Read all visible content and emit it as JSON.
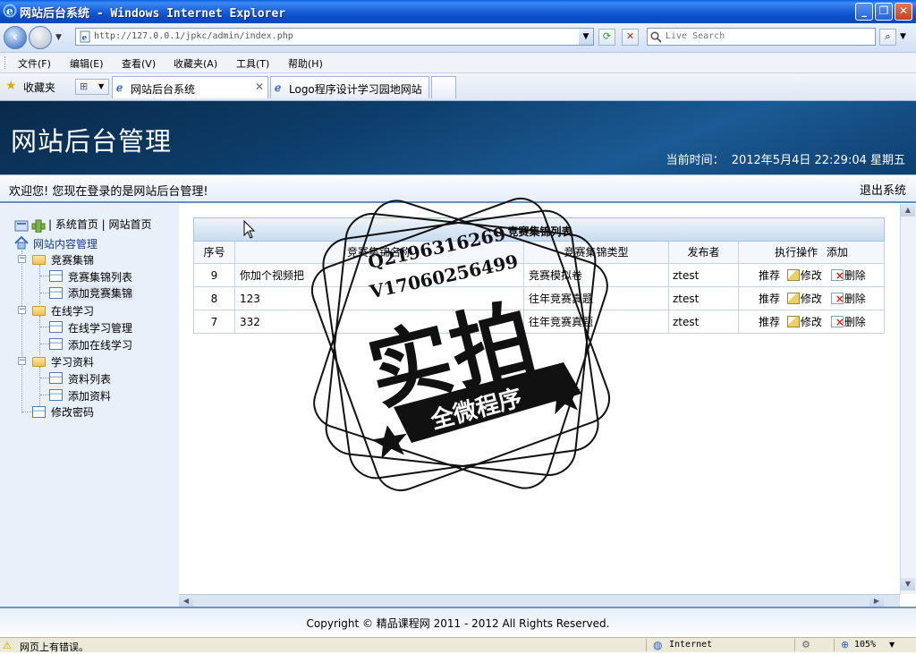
{
  "window": {
    "title": "网站后台系统 - Windows Internet Explorer",
    "minimize": "_",
    "restore": "❐",
    "close": "✕"
  },
  "address": {
    "url": "http://127.0.0.1/jpkc/admin/index.php",
    "search_placeholder": "Live Search"
  },
  "menu": [
    "文件(F)",
    "编辑(E)",
    "查看(V)",
    "收藏夹(A)",
    "工具(T)",
    "帮助(H)"
  ],
  "favorites_label": "收藏夹",
  "tabs": [
    {
      "label": "网站后台系统",
      "active": true
    },
    {
      "label": "Logo程序设计学习园地网站",
      "active": false
    }
  ],
  "header": {
    "site_title": "网站后台管理",
    "time_label": "当前时间：",
    "time_value": "2012年5月4日 22:29:04 星期五"
  },
  "welcome": {
    "text": "欢迎您! 您现在登录的是网站后台管理!",
    "logout": "退出系统"
  },
  "sidebar": {
    "top_links": "| 系统首页 | 网站首页",
    "root": "网站内容管理",
    "groups": [
      {
        "label": "竞赛集锦",
        "items": [
          "竞赛集锦列表",
          "添加竞赛集锦"
        ]
      },
      {
        "label": "在线学习",
        "items": [
          "在线学习管理",
          "添加在线学习"
        ]
      },
      {
        "label": "学习资料",
        "items": [
          "资料列表",
          "添加资料"
        ]
      }
    ],
    "change_password": "修改密码"
  },
  "table": {
    "caption": "竞赛集锦列表",
    "columns": [
      "序号",
      "竞赛集锦名称",
      "竞赛集锦类型",
      "发布者",
      "执行操作",
      "添加"
    ],
    "rows": [
      {
        "id": "9",
        "name": "你加个视频把",
        "type": "竞赛模拟卷",
        "author": "ztest"
      },
      {
        "id": "8",
        "name": "123",
        "type": "往年竞赛真题",
        "author": "ztest"
      },
      {
        "id": "7",
        "name": "332",
        "type": "往年竞赛真题",
        "author": "ztest"
      }
    ],
    "actions": {
      "recommend": "推荐",
      "edit": "修改",
      "delete": "删除"
    }
  },
  "footer": "Copyright © 精品课程网  2011 - 2012 All Rights Reserved.",
  "status": {
    "left": "网页上有错误。",
    "zone": "Internet",
    "zoom": "105%"
  },
  "watermark": {
    "line1": "Q2196316269",
    "line2": "V17060256499",
    "big": "实拍",
    "banner": "全微程序"
  }
}
